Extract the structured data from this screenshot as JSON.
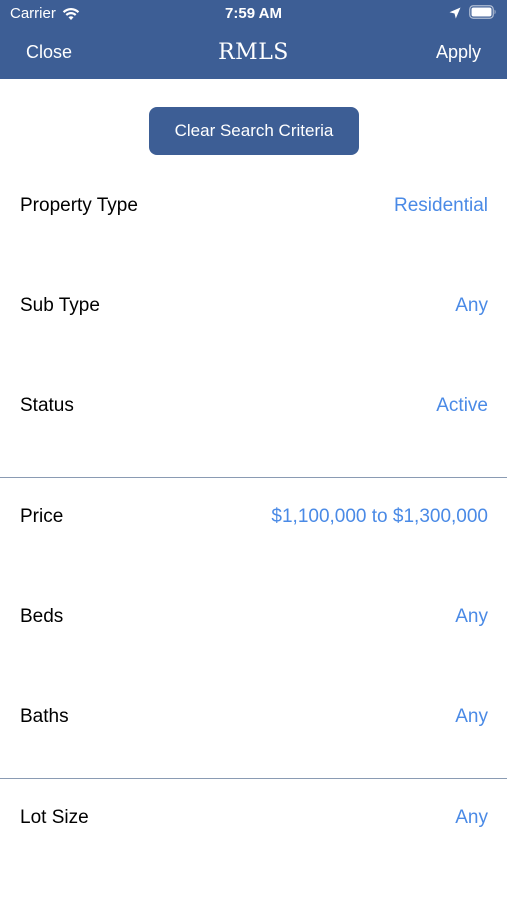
{
  "status_bar": {
    "carrier": "Carrier",
    "time": "7:59 AM"
  },
  "nav": {
    "left_label": "Close",
    "title": "RMLS",
    "right_label": "Apply"
  },
  "clear_button": {
    "label": "Clear Search Criteria"
  },
  "colors": {
    "header": "#3d5e95",
    "accent_value": "#4a8ae6",
    "divider": "#8a9bb3"
  },
  "rows": [
    {
      "label": "Property Type",
      "value": "Residential"
    },
    {
      "label": "Sub Type",
      "value": "Any"
    },
    {
      "label": "Status",
      "value": "Active"
    },
    {
      "label": "Price",
      "value": "$1,100,000 to $1,300,000"
    },
    {
      "label": "Beds",
      "value": "Any"
    },
    {
      "label": "Baths",
      "value": "Any"
    },
    {
      "label": "Lot Size",
      "value": "Any"
    }
  ],
  "icons": {
    "wifi": "wifi-icon",
    "location": "location-arrow-icon",
    "battery": "battery-icon"
  }
}
